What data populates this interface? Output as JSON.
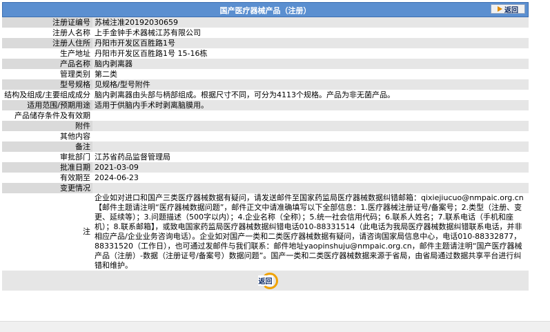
{
  "header": {
    "title": "国产医疗器械产品（注册）",
    "back_label": "返回"
  },
  "rows": [
    {
      "label": "注册证编号",
      "value": "苏械注准20192030659"
    },
    {
      "label": "注册人名称",
      "value": "上手金钟手术器械江苏有限公司"
    },
    {
      "label": "注册人住所",
      "value": "丹阳市开发区百胜路1号"
    },
    {
      "label": "生产地址",
      "value": "丹阳市开发区百胜路1号 15-16栋"
    },
    {
      "label": "产品名称",
      "value": "脑内剥离器"
    },
    {
      "label": "管理类别",
      "value": "第二类"
    },
    {
      "label": "型号规格",
      "value": "见规格/型号附件"
    },
    {
      "label": "结构及组成/主要组成成分",
      "value": "脑内剥离器由头部与柄部组成。根据尺寸不同，可分为4113个规格。产品为非无菌产品。"
    },
    {
      "label": "适用范围/预期用途",
      "value": "适用于供脑内手术时剥离脑膜用。"
    },
    {
      "label": "产品储存条件及有效期",
      "value": ""
    },
    {
      "label": "附件",
      "value": ""
    },
    {
      "label": "其他内容",
      "value": ""
    },
    {
      "label": "备注",
      "value": ""
    },
    {
      "label": "审批部门",
      "value": "江苏省药品监督管理局"
    },
    {
      "label": "批准日期",
      "value": "2021-03-09"
    },
    {
      "label": "有效期至",
      "value": "2024-06-23"
    },
    {
      "label": "变更情况",
      "value": ""
    }
  ],
  "note": {
    "label": "注",
    "text": "企业如对进口和国产三类医疗器械数据有疑问，请发送邮件至国家药监局医疗器械数据纠错邮箱：qixiejiucuo@nmpaic.org.cn【邮件主题请注明“医疗器械数据问题”，邮件正文中请准确填写以下全部信息：1.医疗器械注册证号/备案号；2.类型（注册、变更、延续等）；3.问题描述（500字以内）；4.企业名称（全称）；5.统一社会信用代码；6.联系人姓名；7.联系电话（手机和座机）；8.联系邮箱】，或致电国家药监局医疗器械数据纠错电话010-88331514（此电话为我局医疗器械数据纠错联系电话，并非相应产品/企业业务咨询电话）。企业如对国产一类和二类医疗器械数据有疑问，请咨询国家局信息中心，电话010-88332877，88331520（工作日），也可通过发邮件与我们联系：邮件地址yaopinshuju@nmpaic.org.cn，邮件主题请注明“国产医疗器械产品（注册）-数据（注册证号/备案号）数据问题”。国产一类和二类医疗器械数据来源于省局，由省局通过数据共享平台进行纠错和维护。"
  },
  "footer": {
    "back_label": "返回"
  }
}
